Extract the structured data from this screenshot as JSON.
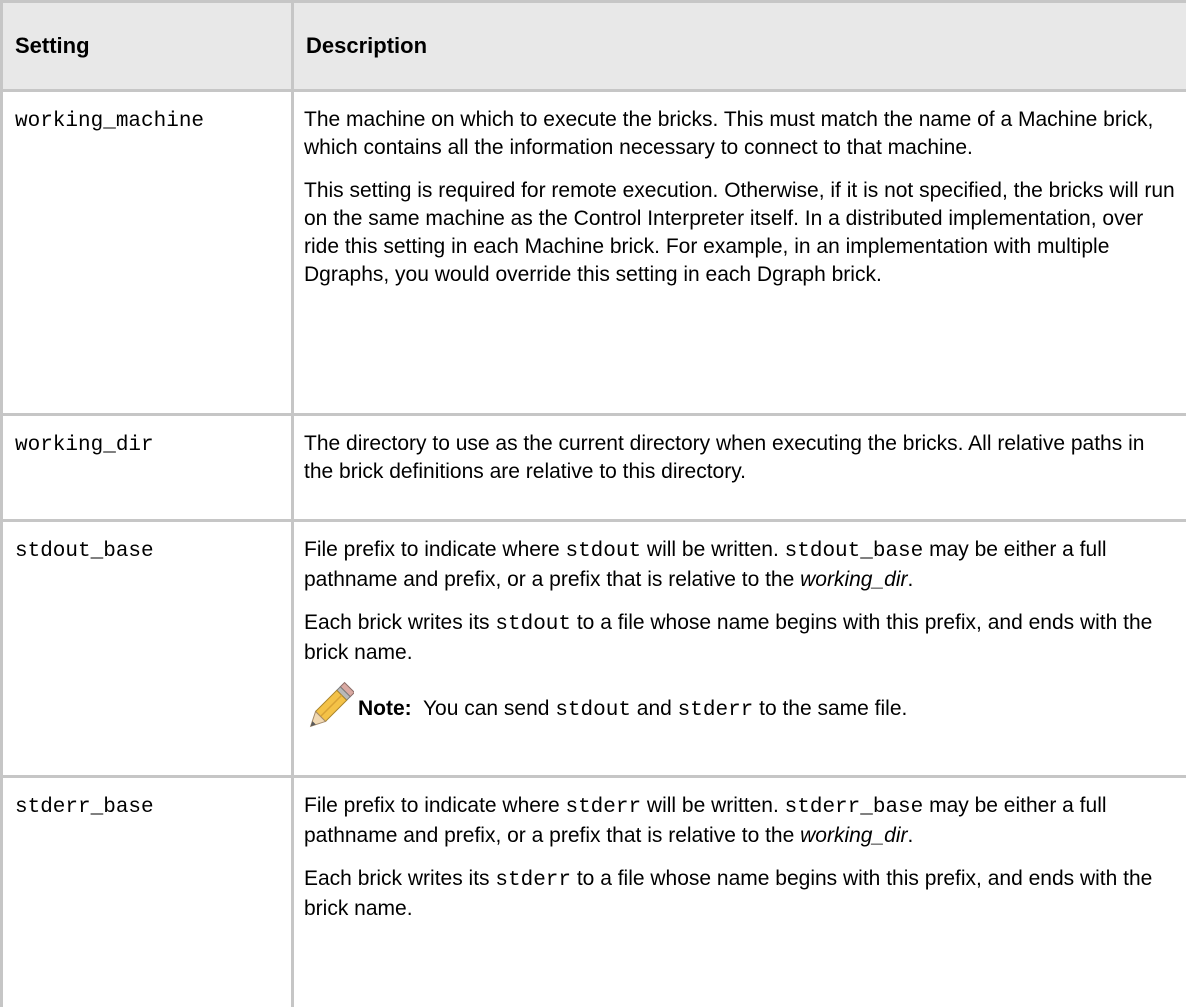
{
  "header": {
    "setting": "Setting",
    "description": "Description"
  },
  "rows": [
    {
      "setting": "working_machine",
      "p1": "The machine on which to execute the bricks. This must match the name of a Machine brick, which contains all the information necessary to connect to that machine.",
      "p2": "This setting is required for remote execution. Otherwise, if it is not specified, the bricks will run on the same machine as the Control Interpreter itself. In a distributed implementation, over ride this setting in each Machine brick. For example, in an implementation with multiple Dgraphs, you would override this setting in each Dgraph brick."
    },
    {
      "setting": "working_dir",
      "p1": "The directory to use as the current directory when executing the bricks. All relative paths in the brick definitions are relative to this directory."
    },
    {
      "setting": "stdout_base",
      "p1_a": "File prefix to indicate where ",
      "p1_code1": "stdout",
      "p1_b": " will be written. ",
      "p1_code2": "stdout_base",
      "p1_c": " may be either a full pathname and prefix, or a prefix that is relative to the ",
      "p1_em": "working_dir",
      "p1_d": ".",
      "p2_a": "Each brick writes its ",
      "p2_code": "stdout",
      "p2_b": " to a file whose name begins with this prefix, and ends with the brick name.",
      "note_label": "Note:",
      "note_a": "  You can send ",
      "note_code1": "stdout",
      "note_b": " and ",
      "note_code2": "stderr",
      "note_c": " to the same file."
    },
    {
      "setting": "stderr_base",
      "p1_a": "File prefix to indicate where ",
      "p1_code1": "stderr",
      "p1_b": " will be written. ",
      "p1_code2": "stderr_base",
      "p1_c": " may be either a full pathname and prefix, or a prefix that is relative to the ",
      "p1_em": "working_dir",
      "p1_d": ".",
      "p2_a": "Each brick writes its ",
      "p2_code": "stderr",
      "p2_b": " to a file whose name begins with this prefix, and ends with the brick name."
    }
  ],
  "icons": {
    "note": "pencil-icon"
  }
}
